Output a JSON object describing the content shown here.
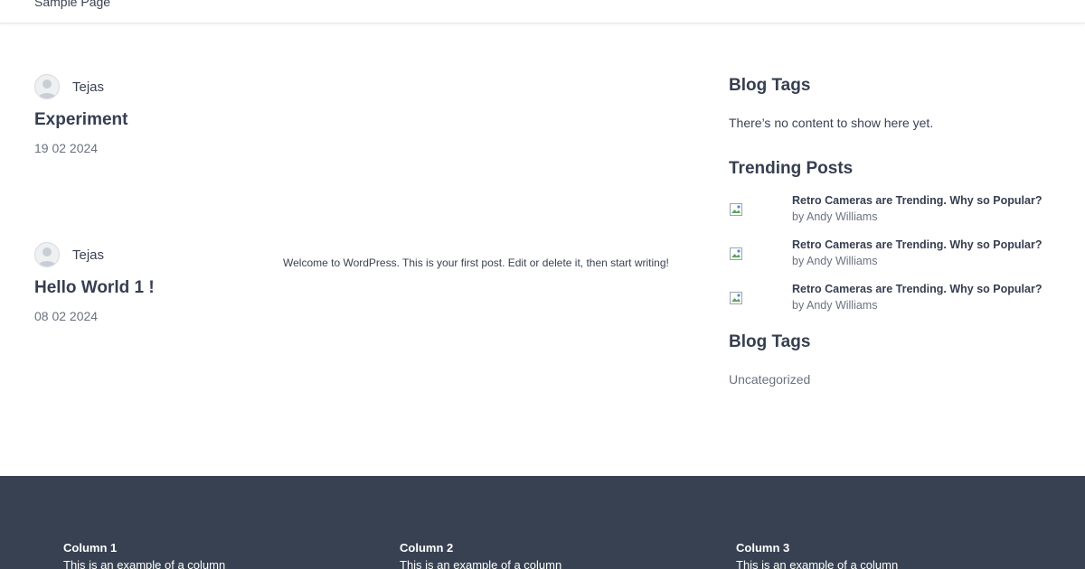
{
  "header": {
    "nav_label": "Sample Page"
  },
  "posts": [
    {
      "author": "Tejas",
      "title": "Experiment",
      "date": "19 02 2024",
      "excerpt": ""
    },
    {
      "author": "Tejas",
      "title": "Hello World 1 !",
      "date": "08 02 2024",
      "excerpt": "Welcome to WordPress. This is your first post. Edit or delete it, then start writing!"
    }
  ],
  "sidebar": {
    "blog_tags_title": "Blog Tags",
    "blog_tags_empty": "There’s no content to show here yet.",
    "trending_title": "Trending Posts",
    "trending": [
      {
        "title": "Retro Cameras are Trending. Why so Popular?",
        "author": "by Andy Williams"
      },
      {
        "title": "Retro Cameras are Trending. Why so Popular?",
        "author": "by Andy Williams"
      },
      {
        "title": "Retro Cameras are Trending. Why so Popular?",
        "author": "by Andy Williams"
      }
    ],
    "blog_tags_title_2": "Blog Tags",
    "tag_uncategorized": "Uncategorized"
  },
  "footer": {
    "columns": [
      {
        "title": "Column 1",
        "text": "This is an example of a column"
      },
      {
        "title": "Column 2",
        "text": "This is an example of a column"
      },
      {
        "title": "Column 3",
        "text": "This is an example of a column"
      }
    ]
  },
  "colors": {
    "footer_bg": "#374151",
    "heading": "#363e50",
    "muted": "#6b7280"
  }
}
